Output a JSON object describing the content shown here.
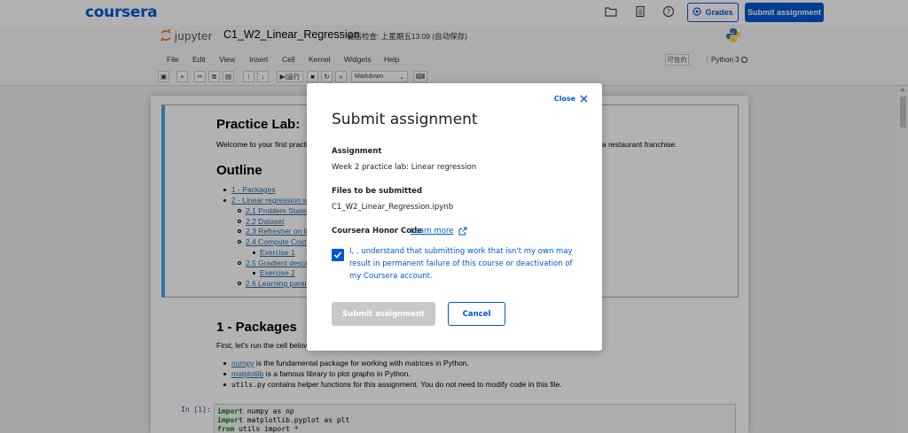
{
  "coursera": {
    "brand": "coursera",
    "grades_label": "Grades",
    "submit_label": "Submit assignment",
    "icons": [
      "folder-icon",
      "document-icon",
      "help-icon",
      "grades-icon"
    ]
  },
  "jupyter": {
    "logo_text": "jupyter",
    "notebook_name": "C1_W2_Linear_Regression",
    "save_status": "最后检查: 上星期五13:09  (自动保存)",
    "menu": [
      "File",
      "Edit",
      "View",
      "Insert",
      "Cell",
      "Kernel",
      "Widgets",
      "Help"
    ],
    "trusted": "可信的",
    "kernel": "Python 3",
    "toolbar": {
      "run_label": "运行",
      "cell_type": "Markdown"
    }
  },
  "notebook": {
    "title": "Practice Lab:",
    "intro_left": "Welcome to your first practic",
    "intro_right": "a restaurant franchise.",
    "outline_heading": "Outline",
    "outline_items": [
      "1 - Packages",
      "2 - Linear regression w",
      "2.1 Problem Staten",
      "2.2 Dataset",
      "2.3 Refresher on li",
      "2.4 Compute Cost",
      "Exercise 1",
      "2.5 Gradient desce",
      "Exercise 2",
      "2.6 Learning paran"
    ],
    "packages_heading": "1 - Packages",
    "packages_intro": "First, let's run the cell below",
    "bullets": [
      {
        "link": "numpy",
        "text": " is the fundamental package for working with matrices in Python."
      },
      {
        "link": "matplotlib",
        "text": " is a famous library to plot graphs in Python."
      },
      {
        "link": "utils.py",
        "text": " contains helper functions for this assignment. You do not need to modify code in this file."
      }
    ],
    "code_prompt": "In  [1]:",
    "code_lines": [
      {
        "kw": "import",
        "rest": " numpy as np"
      },
      {
        "kw": "import",
        "rest": " matplotlib.pyplot as plt"
      },
      {
        "kw": "from",
        "rest": " utils import *"
      }
    ]
  },
  "modal": {
    "close_label": "Close",
    "title": "Submit assignment",
    "assignment_label": "Assignment",
    "assignment_value": "Week 2 practice lab: Linear regression",
    "files_label": "Files to be submitted",
    "files_value": "C1_W2_Linear_Regression.ipynb",
    "honor_label": "Coursera Honor Code",
    "learn_more": "Learn more",
    "honor_text": "I, , understand that submitting work that isn't my own may result in permanent failure of this course or deactivation of my Coursera account.",
    "honor_checked": true,
    "submit_button": "Submit assignment",
    "cancel_button": "Cancel",
    "accent_color": "#0056d2"
  }
}
